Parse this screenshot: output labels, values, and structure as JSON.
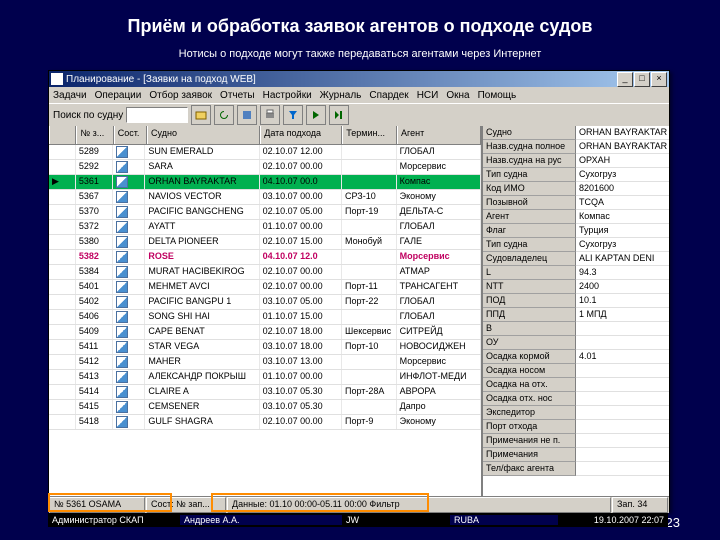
{
  "slide": {
    "title": "Приём и обработка заявок агентов о подходе судов",
    "subtitle": "Нотисы о подходе могут также передаваться агентами через Интернет",
    "page_number": "23"
  },
  "app": {
    "window_title": "Планирование - [Заявки на подход WEB]",
    "menu": [
      "Задачи",
      "Операции",
      "Отбор заявок",
      "Отчеты",
      "Настройки",
      "Журналь",
      "Спардек",
      "НСИ",
      "Окна",
      "Помощь"
    ],
    "toolbar_label": "Поиск по судну",
    "columns": [
      "№ з...",
      "Сост.",
      "Судно",
      "Дата подхода",
      "Термин...",
      "Агент"
    ],
    "rows": [
      {
        "id": "5289",
        "ship": "SUN EMERALD",
        "date": "02.10.07 12.00",
        "term": "",
        "agent": "ГЛОБАЛ"
      },
      {
        "id": "5292",
        "ship": "SARA",
        "date": "02.10.07 00.00",
        "term": "",
        "agent": "Морсервис"
      },
      {
        "id": "5361",
        "ship": "ORHAN BAYRAKTAR",
        "date": "04.10.07 00.0",
        "term": "",
        "agent": "Компас",
        "sel": true
      },
      {
        "id": "5367",
        "ship": "NAVIOS VECTOR",
        "date": "03.10.07 00.00",
        "term": "СРЗ-10",
        "agent": "Эконому"
      },
      {
        "id": "5370",
        "ship": "PACIFIC BANGCHENG",
        "date": "02.10.07 05.00",
        "term": "Порт-19",
        "agent": "ДЕЛЬТА-С"
      },
      {
        "id": "5372",
        "ship": "AYATT",
        "date": "01.10.07 00.00",
        "term": "",
        "agent": "ГЛОБАЛ"
      },
      {
        "id": "5380",
        "ship": "DELTA PIONEER",
        "date": "02.10.07 15.00",
        "term": "Монобуй",
        "agent": "ГАЛЕ"
      },
      {
        "id": "5382",
        "ship": "ROSE",
        "date": "04.10.07 12.0",
        "term": "",
        "agent": "Морсервис",
        "pink": true
      },
      {
        "id": "5384",
        "ship": "MURAT HACIBEKIROG",
        "date": "02.10.07 00.00",
        "term": "",
        "agent": "АТМАР"
      },
      {
        "id": "5401",
        "ship": "MEHMET AVCI",
        "date": "02.10.07 00.00",
        "term": "Порт-11",
        "agent": "ТРАНСАГЕНТ"
      },
      {
        "id": "5402",
        "ship": "PACIFIC BANGPU 1",
        "date": "03.10.07 05.00",
        "term": "Порт-22",
        "agent": "ГЛОБАЛ"
      },
      {
        "id": "5406",
        "ship": "SONG SHI HAI",
        "date": "01.10.07 15.00",
        "term": "",
        "agent": "ГЛОБАЛ"
      },
      {
        "id": "5409",
        "ship": "CAPE BENAT",
        "date": "02.10.07 18.00",
        "term": "Шексервис",
        "agent": "СИТРЕЙД"
      },
      {
        "id": "5411",
        "ship": "STAR VEGA",
        "date": "03.10.07 18.00",
        "term": "Порт-10",
        "agent": "НОВОСИДЖЕН"
      },
      {
        "id": "5412",
        "ship": "MAHER",
        "date": "03.10.07 13.00",
        "term": "",
        "agent": "Морсервис"
      },
      {
        "id": "5413",
        "ship": "АЛЕКСАНДР ПОКРЫШ",
        "date": "01.10.07 00.00",
        "term": "",
        "agent": "ИНФЛОТ-МЕДИ"
      },
      {
        "id": "5414",
        "ship": "CLAIRE A",
        "date": "03.10.07 05.30",
        "term": "Порт-28А",
        "agent": "АВРОРА"
      },
      {
        "id": "5415",
        "ship": "CEMSENER",
        "date": "03.10.07 05.30",
        "term": "",
        "agent": "Дапро"
      },
      {
        "id": "5418",
        "ship": "GULF SHAGRA",
        "date": "02.10.07 00.00",
        "term": "Порт-9",
        "agent": "Эконому"
      }
    ],
    "side": [
      {
        "k": "Судно",
        "v": "ORHAN BAYRAKTAR"
      },
      {
        "k": "Назв.судна полное",
        "v": "ORHAN BAYRAKTAR"
      },
      {
        "k": "Назв.судна на рус",
        "v": "ОРХАН"
      },
      {
        "k": "Тип судна",
        "v": "Сухогруз"
      },
      {
        "k": "Код ИМО",
        "v": "8201600"
      },
      {
        "k": "Позывной",
        "v": "TCQA"
      },
      {
        "k": "Агент",
        "v": "Компас"
      },
      {
        "k": "Флаг",
        "v": "Турция"
      },
      {
        "k": "Тип судна",
        "v": "Сухогруз"
      },
      {
        "k": "Судовладелец",
        "v": "ALI KAPTAN DENI"
      },
      {
        "k": "L",
        "v": "94.3"
      },
      {
        "k": "NTT",
        "v": "2400"
      },
      {
        "k": "ПОД",
        "v": "10.1"
      },
      {
        "k": "ППД",
        "v": "1 МПД"
      },
      {
        "k": "B",
        "v": ""
      },
      {
        "k": "ОУ",
        "v": ""
      },
      {
        "k": "Осадка кормой",
        "v": "4.01"
      },
      {
        "k": "Осадка носом",
        "v": ""
      },
      {
        "k": "Осадка на отх.",
        "v": ""
      },
      {
        "k": "Осадка отх. нос",
        "v": ""
      },
      {
        "k": "Экспедитор",
        "v": ""
      },
      {
        "k": "Порт отхода",
        "v": ""
      },
      {
        "k": "Примечания не п.",
        "v": ""
      },
      {
        "k": "Примечания",
        "v": ""
      },
      {
        "k": "Тел/факс агента",
        "v": ""
      }
    ],
    "status": {
      "left": "№ 5361 OSAMA",
      "mid1": "Сост: № зап...",
      "mid2": "Данные: 01.10 00:00-05.11 00:00 Фильтр",
      "right": "Зап. 34",
      "admin": "Администратор СКАП",
      "user": "Андреев А.А.",
      "r2": "JW",
      "r3": "RUBA",
      "ts": "19.10.2007 22:07"
    }
  }
}
